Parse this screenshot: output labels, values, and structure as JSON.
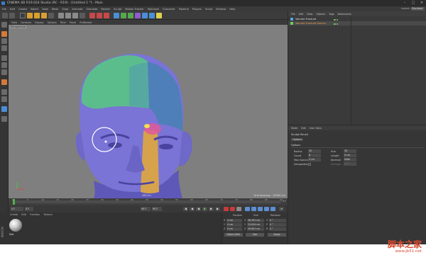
{
  "titlebar": {
    "title": "CINEMA 4D R19.024 Studio (RC - R19) - [Untitled 1 *] - Main"
  },
  "menubar": {
    "items": [
      "File",
      "Edit",
      "Create",
      "Select",
      "Tools",
      "Mesh",
      "Snap",
      "Animate",
      "Simulate",
      "Render",
      "Sculpt",
      "Motion Tracker",
      "MoGraph",
      "Character",
      "Pipeline",
      "Plugins",
      "Script",
      "Window",
      "Help"
    ]
  },
  "layout": {
    "label": "Layout:",
    "value": "Standard"
  },
  "viewport": {
    "menu": [
      "View",
      "Cameras",
      "Display",
      "Options",
      "Filter",
      "Panel",
      "ProRender"
    ],
    "label": "Perspective",
    "grid": "Grid Spacing : 10000 cm",
    "scale": "100 cm"
  },
  "timeline": {
    "ticks": [
      "0",
      "5",
      "10",
      "15",
      "20",
      "25",
      "30",
      "35",
      "40",
      "45",
      "50",
      "55",
      "60",
      "65",
      "70",
      "75",
      "80",
      "85",
      "90"
    ],
    "frame": "0 F",
    "progress": 0
  },
  "transport": {
    "start": "0 F",
    "current": "0 F",
    "end": "90 F",
    "end2": "90 F"
  },
  "material_manager": {
    "menu": [
      "Create",
      "Edit",
      "Function",
      "Texture"
    ],
    "material_name": "Mat"
  },
  "coordinates": {
    "headers": [
      "Position",
      "Size",
      "Rotation"
    ],
    "position": [
      "0 cm",
      "0 cm",
      "0 cm"
    ],
    "size": [
      "36.391 cm",
      "22.619 cm",
      "29.601 cm"
    ],
    "rotation": [
      "0 °",
      "0 °",
      "0 °"
    ],
    "axes_pos": [
      "X",
      "Y",
      "Z"
    ],
    "axes_size": [
      "X",
      "Y",
      "Z"
    ],
    "axes_rot": [
      "H",
      "P",
      "B"
    ],
    "mode_button": "Object (Rel)",
    "size_button": "Size",
    "apply_button": "Apply"
  },
  "object_manager": {
    "menu": [
      "File",
      "Edit",
      "View",
      "Objects",
      "Tags",
      "Bookmarks"
    ],
    "objects": [
      "Volume Fracture",
      "Volume Fracture Source"
    ]
  },
  "attribute_manager": {
    "menu": [
      "Mode",
      "Edit",
      "User Data"
    ],
    "title": "Sculpt Brush",
    "tab": "Options",
    "section": "Options",
    "fields": {
      "radius_label": "Radius",
      "radius_value": "30",
      "count_label": "Count",
      "count_value": "8",
      "max_spacing_label": "Max Spacing",
      "max_spacing_value": "5 cm",
      "interpolated_label": "Interpolated",
      "hue_label": "Hue",
      "hue_value": "30",
      "length_label": "Length",
      "length_value": "0 cm",
      "stamp_label": "Nominal",
      "stamp_value": "Slide",
      "strength_label": "Strength",
      "strength_value": "4 %"
    }
  },
  "watermark": {
    "logo": "脚本之家",
    "url": "www.jb51.net"
  },
  "colors": {
    "accent": "#f0a04a",
    "head_skin": "#7a74d6",
    "mask_green": "#5cbd8c",
    "mask_blue": "#4e7fb8",
    "mask_orange": "#d6a24c"
  }
}
